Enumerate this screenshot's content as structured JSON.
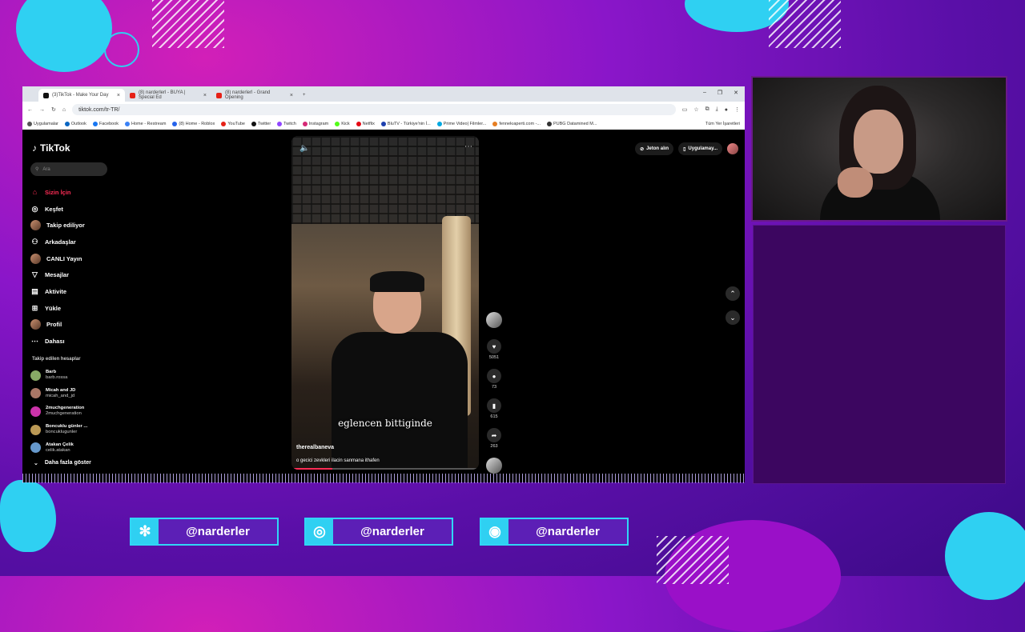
{
  "browser": {
    "tabs": [
      {
        "label": "(3)TikTok - Make Your Day",
        "active": true
      },
      {
        "label": "(8) narderlerl - BUYA | Special Ed",
        "active": false
      },
      {
        "label": "(8) narderlerl - Grand Opening",
        "active": false
      }
    ],
    "new_tab": "+",
    "url": "tiktok.com/tr-TR/",
    "bookmarks": [
      "Uygulamalar",
      "Outlook",
      "Facebook",
      "Home - Restream",
      "(8) Home - Roblox",
      "YouTube",
      "Twitter",
      "Twitch",
      "Instagram",
      "Kick",
      "Netflix",
      "BluTV - Türkiye'nin İ...",
      "Prime Video| Filmler...",
      "fennekıaperti.com -...",
      "PUBG Datamined M..."
    ],
    "all_bookmarks": "Tüm Yer İşaretleri"
  },
  "tiktok": {
    "logo": "TikTok",
    "search_placeholder": "Ara",
    "nav": [
      {
        "label": "Sizin İçin",
        "icon": "home-icon",
        "active": true
      },
      {
        "label": "Keşfet",
        "icon": "compass-icon"
      },
      {
        "label": "Takip ediliyor",
        "icon": "avatar"
      },
      {
        "label": "Arkadaşlar",
        "icon": "friends-icon"
      },
      {
        "label": "CANLI Yayın",
        "icon": "avatar"
      },
      {
        "label": "Mesajlar",
        "icon": "message-icon"
      },
      {
        "label": "Aktivite",
        "icon": "activity-icon"
      },
      {
        "label": "Yükle",
        "icon": "upload-icon"
      },
      {
        "label": "Profil",
        "icon": "avatar"
      },
      {
        "label": "Dahası",
        "icon": "more-icon"
      }
    ],
    "following_title": "Takip edilen hesaplar",
    "following": [
      {
        "name": "Barb",
        "handle": "barb.rossa"
      },
      {
        "name": "Micah and JD",
        "handle": "micah_and_jd"
      },
      {
        "name": "2muchgeneration",
        "handle": "2muchgeneration"
      },
      {
        "name": "Boncuklu günler ...",
        "handle": "boncuklugunler"
      },
      {
        "name": "Atakan Çelik",
        "handle": "celik.atakan"
      }
    ],
    "show_more": "Daha fazla göster",
    "video": {
      "caption": "eglencen bittiginde",
      "author": "therealbaneva",
      "description": "o gecici zevkleri ilacin sanmana ithafen",
      "progress": 0.22
    },
    "actions": {
      "likes": "5051",
      "comments": "73",
      "saves": "615",
      "shares": "263"
    },
    "top_right": {
      "coins": "Jeton alın",
      "app": "Uygulamay..."
    }
  },
  "social": [
    {
      "icon": "✻",
      "handle": "@narderler"
    },
    {
      "icon": "◎",
      "handle": "@narderler"
    },
    {
      "icon": "◉",
      "handle": "@narderler"
    }
  ]
}
